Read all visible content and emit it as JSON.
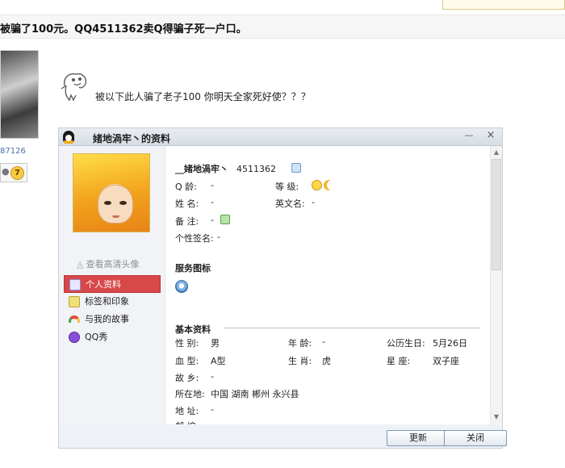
{
  "post": {
    "title": "被骗了100元。QQ4511362卖Q得骗子死一户口。",
    "body": "被以下此人骗了老子100 你明天全家死好使？？？"
  },
  "user": {
    "id_partial": "87126",
    "level": "7"
  },
  "qq_window": {
    "title": "媎地渦牢丶的资料",
    "minimize_label": "—",
    "close_label": "×",
    "avatar_link": "查看高清头像",
    "nav": [
      {
        "label": "个人资料",
        "active": true
      },
      {
        "label": "标签和印象",
        "active": false
      },
      {
        "label": "与我的故事",
        "active": false
      },
      {
        "label": "QQ秀",
        "active": false
      }
    ],
    "profile": {
      "nickname": "__媎地渦牢丶",
      "qq_number": "4511362",
      "age_label": "Q  龄:",
      "age_value": "-",
      "level_label": "等  级:",
      "name_label": "姓  名:",
      "name_value": "-",
      "english_name_label": "英文名:",
      "english_name_value": "-",
      "remark_label": "备  注:",
      "remark_value": "-",
      "signature_label": "个性签名:",
      "signature_value": "-"
    },
    "service_section": {
      "heading": "服务图标"
    },
    "basic_section": {
      "heading": "基本资料",
      "gender_label": "性  别:",
      "gender_value": "男",
      "age_label": "年  龄:",
      "age_value": "-",
      "birthday_label": "公历生日:",
      "birthday_value": "5月26日",
      "blood_label": "血  型:",
      "blood_value": "A型",
      "zodiac_label": "生  肖:",
      "zodiac_value": "虎",
      "constellation_label": "星    座:",
      "constellation_value": "双子座",
      "hometown_label": "故  乡:",
      "hometown_value": "-",
      "location_label": "所在地:",
      "location_value": "中国 湖南 郴州 永兴县",
      "address_label": "地  址:",
      "address_value": "-",
      "postcode_label": "邮  编:",
      "postcode_value": "-"
    },
    "buttons": {
      "update": "更新",
      "close": "关闭"
    }
  }
}
